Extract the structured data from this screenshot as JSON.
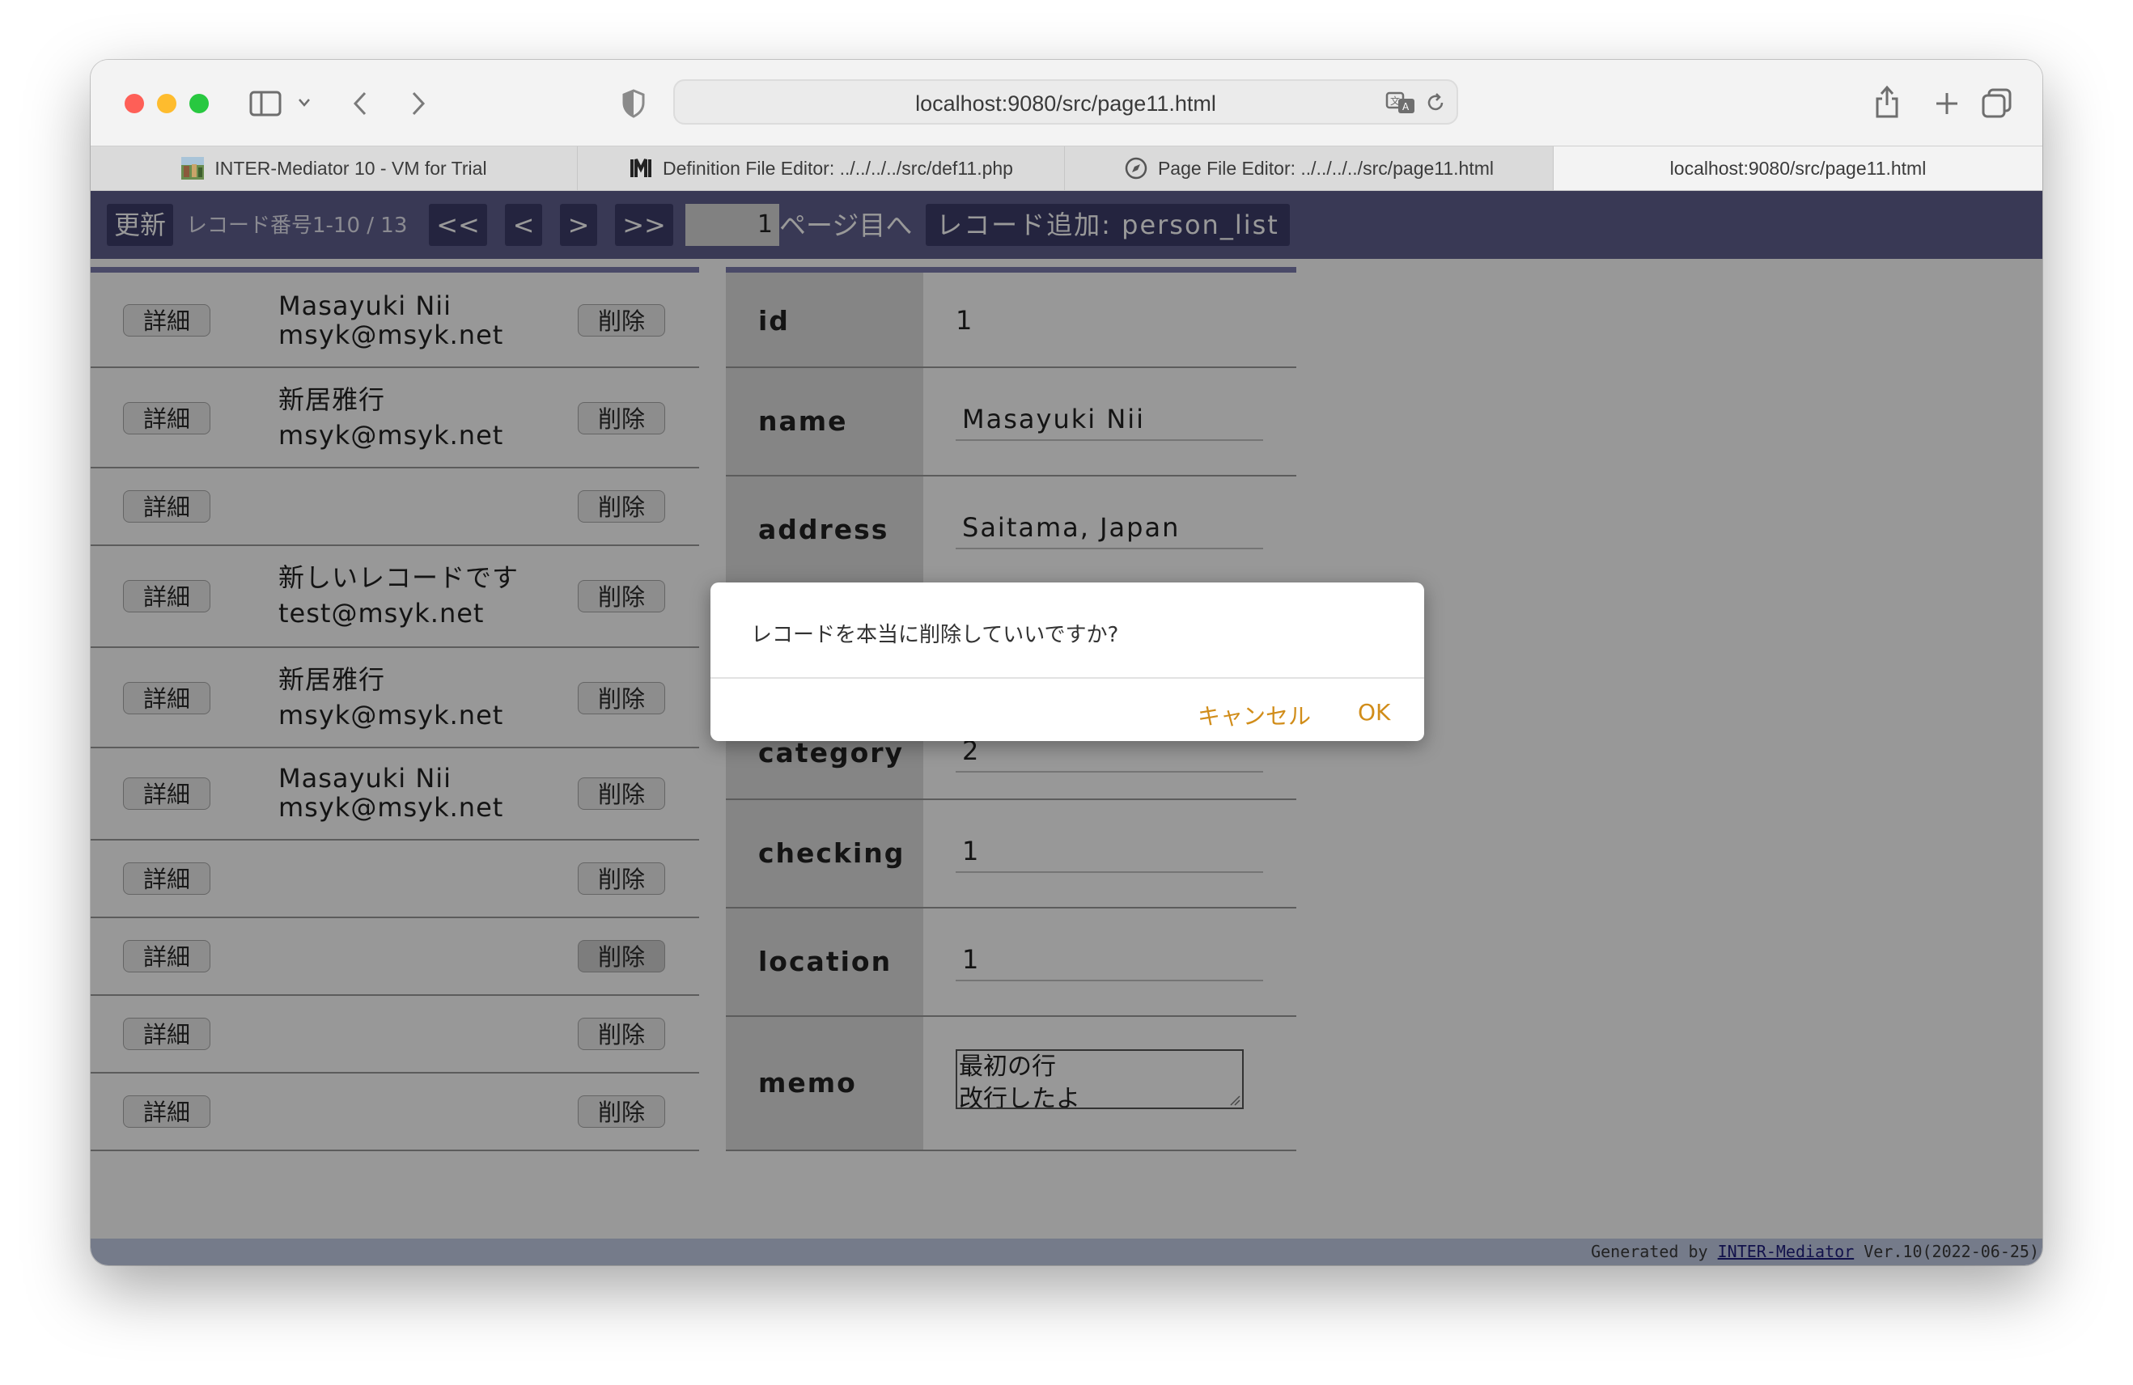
{
  "browser": {
    "url": "localhost:9080/src/page11.html",
    "tabs": [
      {
        "label": "INTER-Mediator 10 - VM for Trial",
        "icon": "photo-favicon-icon"
      },
      {
        "label": "Definition File Editor: ../../../../src/def11.php",
        "icon": "im-logo-favicon-icon"
      },
      {
        "label": "Page File Editor: ../../../../src/page11.html",
        "icon": "compass-favicon-icon"
      },
      {
        "label": "localhost:9080/src/page11.html",
        "icon": ""
      }
    ]
  },
  "navigator": {
    "refresh": "更新",
    "record_info": "レコード番号1-10 / 13",
    "first": "<<",
    "prev": "<",
    "next": ">",
    "last": ">>",
    "page_value": "1",
    "page_suffix": "ページ目へ",
    "add_record": "レコード追加: person_list"
  },
  "list": {
    "detail_label": "詳細",
    "delete_label": "削除",
    "rows": [
      {
        "name": "Masayuki Nii",
        "mail": "msyk@msyk.net"
      },
      {
        "name": "新居雅行",
        "mail": "msyk@msyk.net"
      },
      {
        "name": "",
        "mail": ""
      },
      {
        "name": "新しいレコードです",
        "mail": "test@msyk.net"
      },
      {
        "name": "新居雅行",
        "mail": "msyk@msyk.net"
      },
      {
        "name": "Masayuki Nii",
        "mail": "msyk@msyk.net"
      },
      {
        "name": "",
        "mail": ""
      },
      {
        "name": "",
        "mail": ""
      },
      {
        "name": "",
        "mail": ""
      },
      {
        "name": "",
        "mail": ""
      }
    ]
  },
  "detail": {
    "id_label": "id",
    "id_value": "1",
    "name_label": "name",
    "name_value": "Masayuki Nii",
    "address_label": "address",
    "address_value": "Saitama, Japan",
    "category_label": "category",
    "category_value": "2",
    "checking_label": "checking",
    "checking_value": "1",
    "location_label": "location",
    "location_value": "1",
    "memo_label": "memo",
    "memo_line1": "最初の行",
    "memo_line2": "改行したよ"
  },
  "footer": {
    "prefix": "Generated by",
    "link": "INTER-Mediator",
    "version": "Ver.10(2022-06-25)"
  },
  "dialog": {
    "message": "レコードを本当に削除していいですか?",
    "cancel": "キャンセル",
    "ok": "OK"
  },
  "colors": {
    "navbar": "#5f5f8e",
    "dialog_button": "#d18d1a"
  }
}
